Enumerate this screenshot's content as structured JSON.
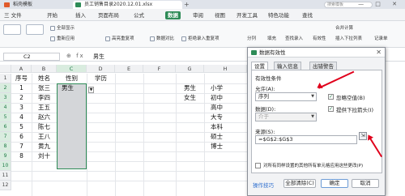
{
  "titlebar": {
    "tabs": [
      {
        "label": "稻壳模板",
        "icon_color": "#e05a2b"
      },
      {
        "label": "员工销售目录2020.12.01.xlsx",
        "icon_color": "#2e8b57"
      }
    ],
    "plus": "+",
    "search_placeholder": "搜索模板",
    "window_controls": "— □ ✕"
  },
  "menubar": {
    "items": [
      "三 文件",
      "开始",
      "插入",
      "页面布局",
      "公式",
      "数据",
      "审阅",
      "视图",
      "开发工具",
      "特色功能",
      "查找"
    ],
    "active": "数据"
  },
  "ribbon": {
    "buttons": [
      "全部显示",
      "重新应用",
      "高亮重复项",
      "数据对比",
      "拒绝录入重复项",
      "分列",
      "填充",
      "查找录入",
      "有效性",
      "插入下拉列表",
      "合并计算",
      "记录单"
    ]
  },
  "formula_bar": {
    "name_box": "C2",
    "icons": "⊕ fx",
    "value": "男生"
  },
  "sheet": {
    "columns": [
      "A",
      "B",
      "C",
      "D",
      "E",
      "F",
      "G",
      "H"
    ],
    "selected_column": "C",
    "header_row": [
      "序号",
      "姓名",
      "性别",
      "学历"
    ],
    "rows": [
      {
        "num": "1",
        "name": "张三",
        "gender": "男生"
      },
      {
        "num": "2",
        "name": "李四",
        "gender": ""
      },
      {
        "num": "3",
        "name": "王五",
        "gender": ""
      },
      {
        "num": "4",
        "name": "赵六",
        "gender": ""
      },
      {
        "num": "5",
        "name": "陈七",
        "gender": ""
      },
      {
        "num": "6",
        "name": "王八",
        "gender": ""
      },
      {
        "num": "7",
        "name": "黄九",
        "gender": ""
      },
      {
        "num": "8",
        "name": "刘十",
        "gender": ""
      }
    ],
    "row_numbers": [
      "1",
      "2",
      "3",
      "4",
      "5",
      "6",
      "7",
      "8",
      "9",
      "10",
      "11",
      "12"
    ],
    "side_gender": [
      "男生",
      "女生"
    ],
    "side_edu": [
      "小学",
      "初中",
      "高中",
      "大专",
      "本科",
      "硕士",
      "博士"
    ]
  },
  "dialog": {
    "title": "数据有效性",
    "close": "✕",
    "tabs": [
      "设置",
      "输入信息",
      "出错警告"
    ],
    "active_tab": "设置",
    "section_label": "有效性条件",
    "allow_label": "允许(A):",
    "allow_value": "序列",
    "data_label": "数据(D):",
    "data_value": "介于",
    "ignore_blank_label": "忽略空值(B)",
    "ignore_blank_checked": true,
    "dropdown_label": "提供下拉箭头(I)",
    "dropdown_checked": true,
    "source_label": "来源(S):",
    "source_value": "=$G$2:$G$3",
    "apply_all_label": "对所有同样设置的其他所有单元格应用这些更改(P)",
    "tips_label": "操作技巧",
    "clear_button": "全部清除(C)",
    "ok_button": "确定",
    "cancel_button": "取消"
  },
  "colors": {
    "accent": "#2e8b57",
    "annotation_arrow": "#e0001b"
  }
}
